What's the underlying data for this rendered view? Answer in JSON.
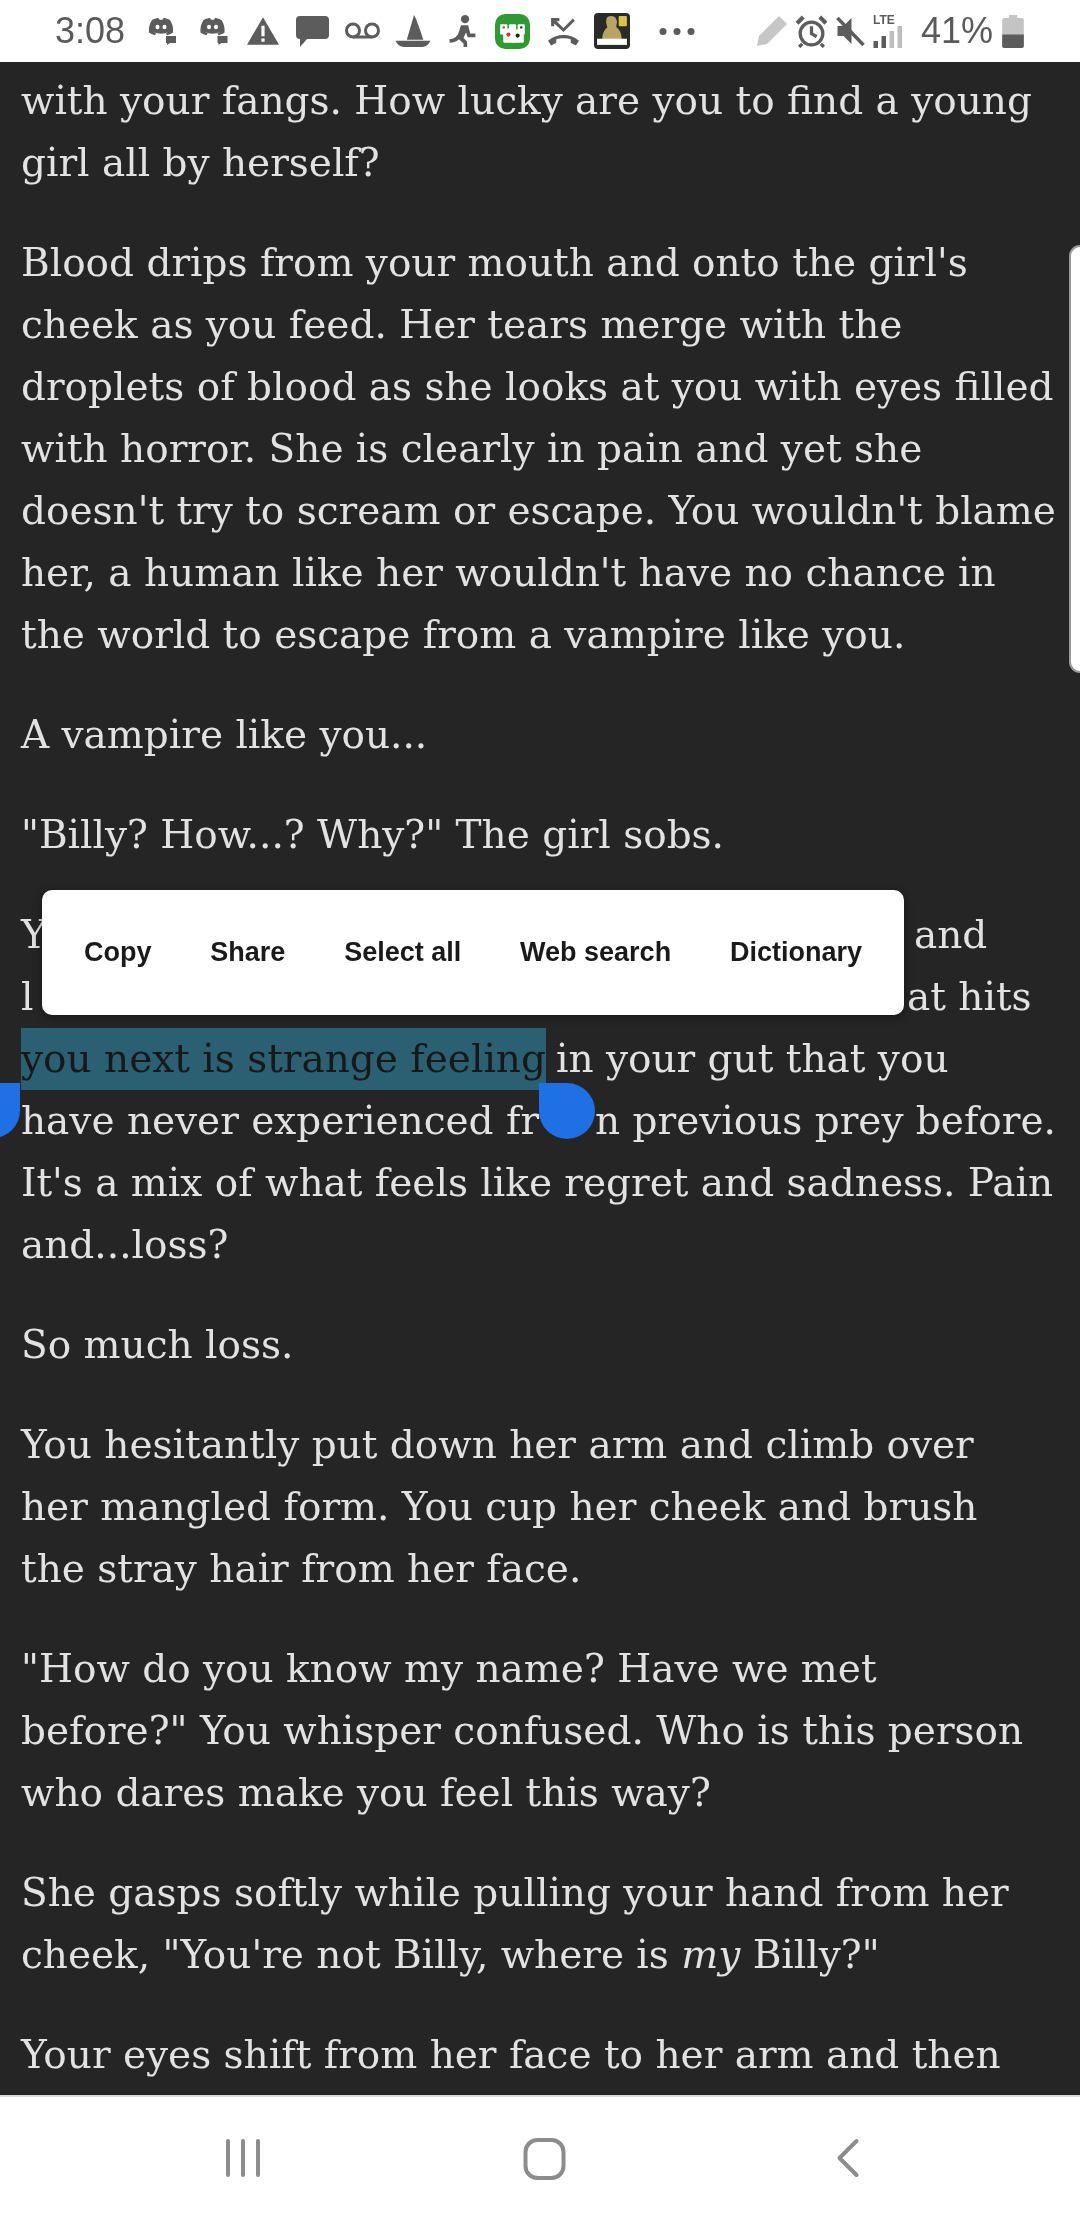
{
  "status_bar": {
    "time": "3:08",
    "network_type": "LTE",
    "battery": "41%"
  },
  "paragraphs": [
    {
      "kind": "text",
      "lines": [
        "with your fangs. How lucky are you to find a young",
        "girl all by herself?"
      ]
    },
    {
      "kind": "text",
      "lines": [
        "Blood drips from your mouth and onto the girl's",
        "cheek as you feed. Her tears merge with the",
        "droplets of blood as she looks at you with eyes filled",
        "with horror. She is clearly in pain and yet she",
        "doesn't try to scream or escape. You wouldn't blame",
        "her, a human like her wouldn't have no chance in",
        "the world to escape from a vampire like you."
      ]
    },
    {
      "kind": "text",
      "lines": [
        "A vampire like you..."
      ]
    },
    {
      "kind": "text",
      "lines": [
        "\"Billy? How...? Why?\" The girl sobs."
      ]
    },
    {
      "kind": "selection",
      "covered_lines": [
        {
          "left": "Y",
          "right": "and"
        },
        {
          "left": "l",
          "right": "at hits"
        }
      ],
      "selected_line": {
        "highlighted_text": "you next is strange feeling",
        "rest": "in your gut that you"
      },
      "handle_line": {
        "left": "have never experienced fr",
        "right": "n previous prey before."
      },
      "lines": [
        "It's a mix of what feels like regret and sadness. Pain",
        "and...loss?"
      ]
    },
    {
      "kind": "text",
      "lines": [
        "So much loss."
      ]
    },
    {
      "kind": "text",
      "lines": [
        "You hesitantly put down her arm and climb over",
        "her mangled form. You cup her cheek and brush",
        "the stray hair from her face."
      ]
    },
    {
      "kind": "text",
      "lines": [
        "\"How do you know my name? Have we met",
        "before?\" You whisper confused. Who is this person",
        "who dares make you feel this way?"
      ]
    },
    {
      "kind": "text",
      "lines": [
        "She gasps softly while pulling your hand from her",
        "cheek, \"You're not Billy, where is *my* Billy?\""
      ]
    },
    {
      "kind": "text",
      "lines": [
        "Your eyes shift from her face to her arm and then"
      ]
    }
  ],
  "text_selection_toolbar": {
    "buttons": [
      "Copy",
      "Share",
      "Select all",
      "Web search",
      "Dictionary"
    ]
  }
}
